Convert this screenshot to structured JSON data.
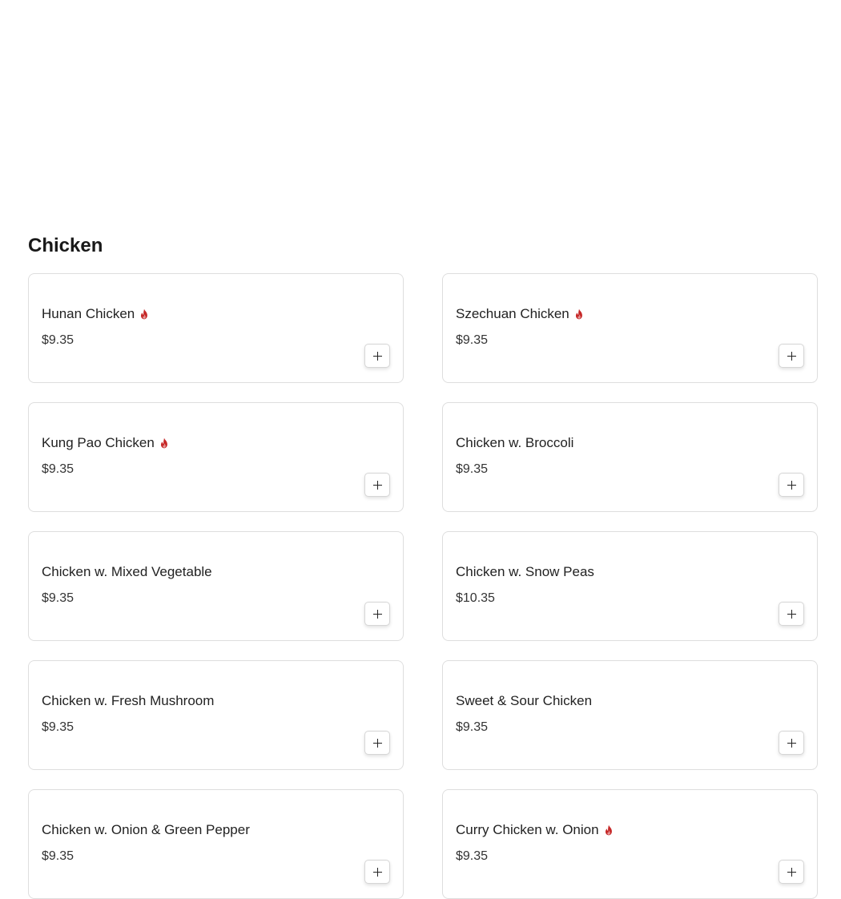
{
  "section": {
    "title": "Chicken"
  },
  "colors": {
    "spicy": "#c62828",
    "card_border": "#dedede"
  },
  "icons": {
    "spicy": "flame-icon",
    "add": "plus-icon"
  },
  "items": [
    {
      "name": "Hunan Chicken",
      "price": "$9.35",
      "spicy": true
    },
    {
      "name": "Szechuan Chicken",
      "price": "$9.35",
      "spicy": true
    },
    {
      "name": "Kung Pao Chicken",
      "price": "$9.35",
      "spicy": true
    },
    {
      "name": "Chicken w. Broccoli",
      "price": "$9.35",
      "spicy": false
    },
    {
      "name": "Chicken w. Mixed Vegetable",
      "price": "$9.35",
      "spicy": false
    },
    {
      "name": "Chicken w. Snow Peas",
      "price": "$10.35",
      "spicy": false
    },
    {
      "name": "Chicken w. Fresh Mushroom",
      "price": "$9.35",
      "spicy": false
    },
    {
      "name": "Sweet & Sour Chicken",
      "price": "$9.35",
      "spicy": false
    },
    {
      "name": "Chicken w. Onion & Green Pepper",
      "price": "$9.35",
      "spicy": false
    },
    {
      "name": "Curry Chicken w. Onion",
      "price": "$9.35",
      "spicy": true
    }
  ]
}
